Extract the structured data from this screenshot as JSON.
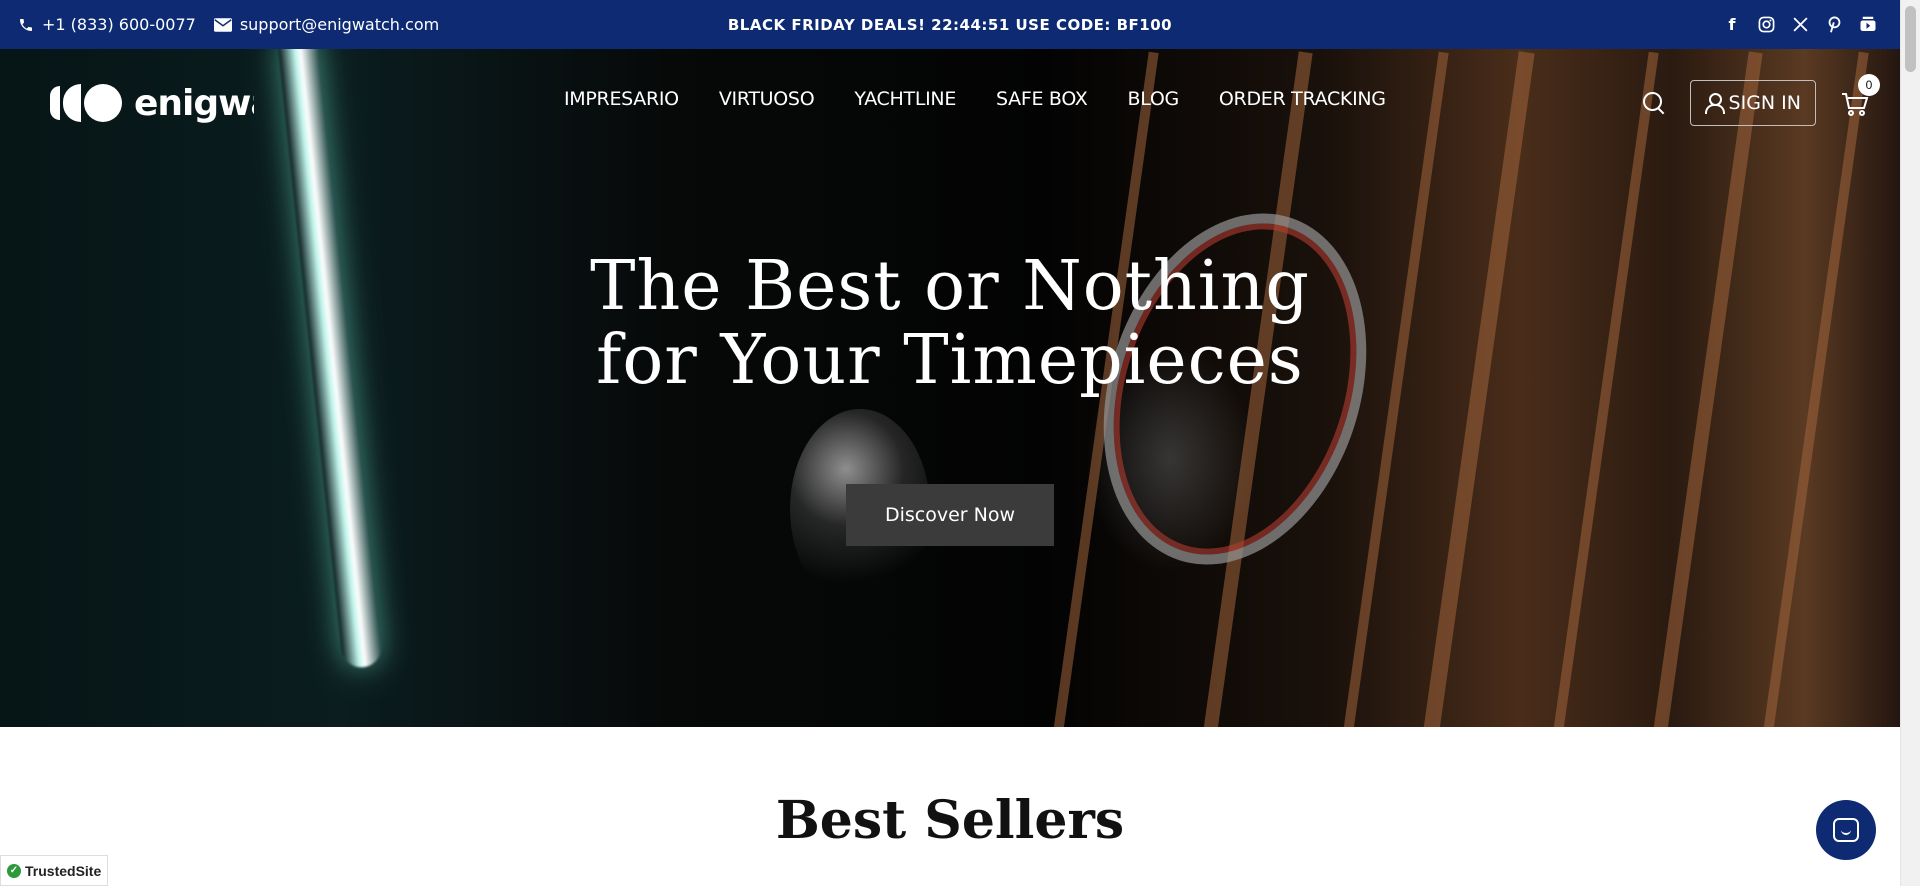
{
  "topbar": {
    "phone": "+1 (833) 600-0077",
    "email": "support@enigwatch.com",
    "promo": "BLACK FRIDAY DEALS! 22:44:51 USE CODE: BF100",
    "social_icons": [
      "facebook-icon",
      "instagram-icon",
      "x-icon",
      "pinterest-icon",
      "youtube-icon"
    ]
  },
  "header": {
    "logo_text": "enigwatch",
    "nav": [
      "IMPRESARIO",
      "VIRTUOSO",
      "YACHTLINE",
      "SAFE BOX",
      "BLOG",
      "ORDER TRACKING"
    ],
    "signin_label": "SIGN IN",
    "cart_count": "0"
  },
  "hero": {
    "title_line1": "The Best or Nothing",
    "title_line2": "for Your Timepieces",
    "cta_label": "Discover Now"
  },
  "sections": {
    "best_sellers_title": "Best Sellers"
  },
  "badges": {
    "trusted_site": "TrustedSite"
  },
  "colors": {
    "topbar_bg": "#0d2a73",
    "chat_button": "#0d2a73",
    "cta_bg": "#3b3b3b"
  }
}
